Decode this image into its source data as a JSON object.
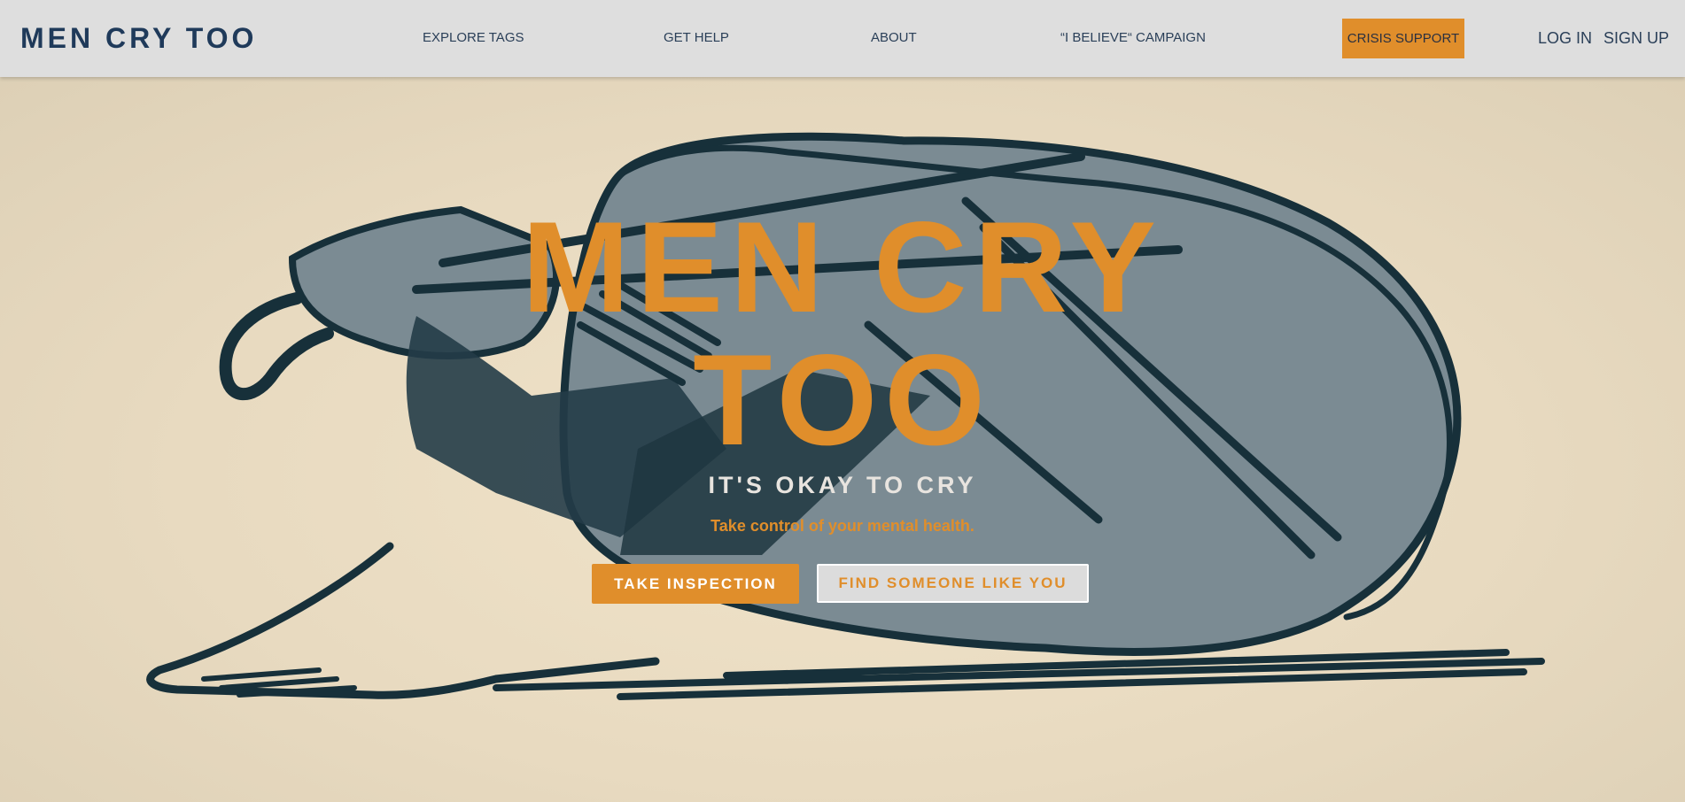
{
  "brand": {
    "name": "MEN CRY TOO"
  },
  "nav": {
    "explore_tags": "EXPLORE TAGS",
    "get_help": "GET HELP",
    "about": "ABOUT",
    "believe_campaign": "“I BELIEVE“ CAMPAIGN",
    "crisis_support": "CRISIS SUPPORT",
    "log_in": "LOG IN",
    "sign_up": "SIGN UP"
  },
  "hero": {
    "title_line1": "MEN CRY",
    "title_line2": "TOO",
    "tagline": "IT'S OKAY TO CRY",
    "subtitle": "Take control of your mental health.",
    "primary_button": "TAKE INSPECTION",
    "secondary_button": "FIND SOMEONE LIKE YOU",
    "illustration": "crying-man-illustration"
  },
  "colors": {
    "accent": "#e08e2b",
    "brand_navy": "#1f3a5a",
    "navbar_bg": "#dedede",
    "hero_bg": "#e6d8bf",
    "figure_fill": "#7b8b93",
    "figure_ink": "#17303a"
  }
}
